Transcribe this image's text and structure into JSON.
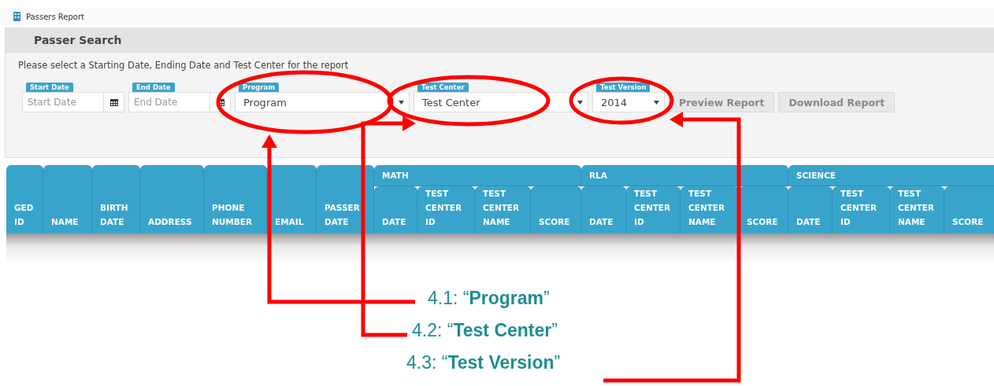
{
  "window": {
    "title": "Passers Report"
  },
  "panel": {
    "title": "Passer Search",
    "instruction": "Please select a Starting Date, Ending Date and Test Center for the report",
    "fields": [
      {
        "kind": "date",
        "label": "Start Date",
        "placeholder": "Start Date"
      },
      {
        "kind": "date",
        "label": "End Date",
        "placeholder": "End Date"
      },
      {
        "kind": "select",
        "label": "Program",
        "value": "Program"
      },
      {
        "kind": "select",
        "label": "Test Center",
        "value": "Test Center"
      },
      {
        "kind": "select",
        "label": "Test Version",
        "value": "2014"
      }
    ],
    "buttons": [
      {
        "label": "Preview Report"
      },
      {
        "label": "Download Report"
      }
    ]
  },
  "table": {
    "columns": [
      {
        "label": "GED ID"
      },
      {
        "label": "NAME"
      },
      {
        "label": "BIRTH DATE"
      },
      {
        "label": "ADDRESS"
      },
      {
        "label": "PHONE NUMBER"
      },
      {
        "label": "EMAIL"
      },
      {
        "label": "PASSER DATE"
      },
      {
        "group": "MATH",
        "children": [
          {
            "label": "DATE"
          },
          {
            "label": "TEST CENTER ID"
          },
          {
            "label": "TEST CENTER NAME"
          },
          {
            "label": "SCORE"
          }
        ]
      },
      {
        "group": "RLA",
        "children": [
          {
            "label": "DATE"
          },
          {
            "label": "TEST CENTER ID"
          },
          {
            "label": "TEST CENTER NAME"
          },
          {
            "label": "SCORE"
          }
        ]
      },
      {
        "group": "SCIENCE",
        "children": [
          {
            "label": "DATE"
          },
          {
            "label": "TEST CENTER ID"
          },
          {
            "label": "TEST CENTER NAME"
          },
          {
            "label": "SCORE"
          }
        ]
      }
    ]
  },
  "annotations": [
    {
      "text": "4.1: “**Program**”"
    },
    {
      "text": "4.2: “**Test Center**”"
    },
    {
      "text": "4.3: “**Test Version**”"
    }
  ]
}
